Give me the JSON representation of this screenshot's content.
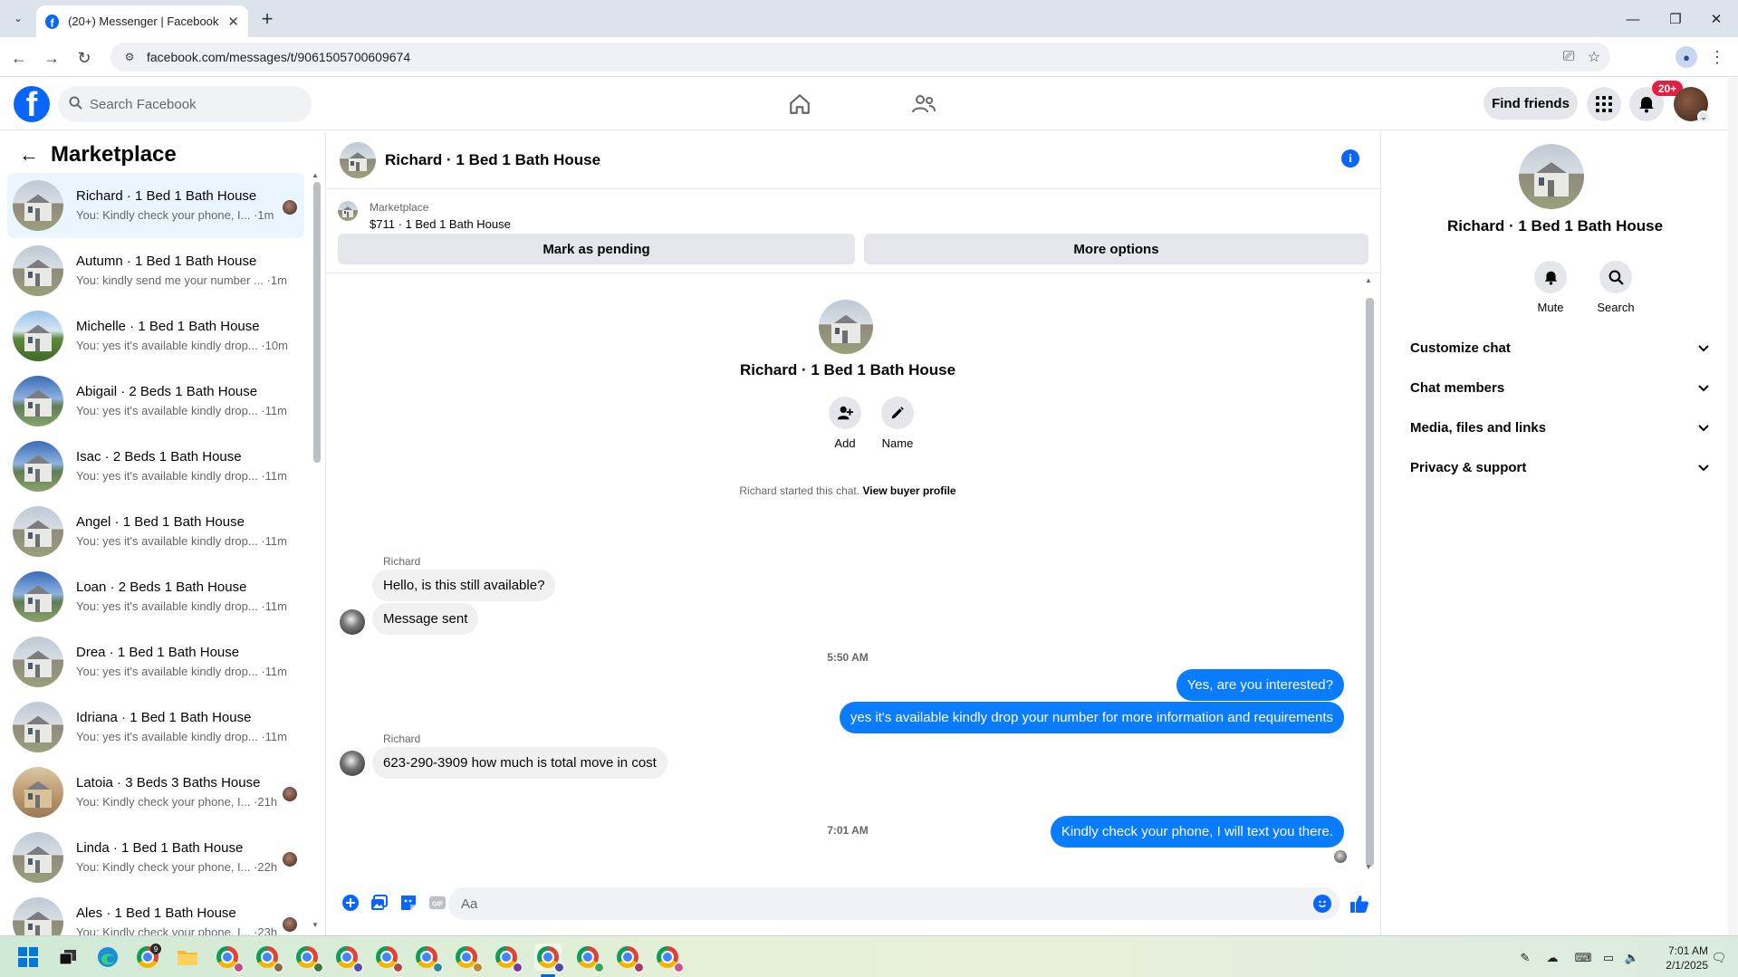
{
  "browser": {
    "tab_title": "(20+) Messenger | Facebook",
    "url": "facebook.com/messages/t/9061505700609674"
  },
  "fbnav": {
    "search_placeholder": "Search Facebook",
    "find_friends": "Find friends",
    "notification_count": "20+"
  },
  "sidebar": {
    "title": "Marketplace",
    "conversations": [
      {
        "name": "Richard · 1 Bed 1 Bath House",
        "preview": "You: Kindly check your phone, I... ·1m",
        "thumb": "gray",
        "seen": true,
        "active": true
      },
      {
        "name": "Autumn · 1 Bed 1 Bath House",
        "preview": "You: kindly send me your number ... ·1m",
        "thumb": "gray",
        "seen": false,
        "active": false
      },
      {
        "name": "Michelle · 1 Bed 1 Bath House",
        "preview": "You: yes it's available kindly drop... ·10m",
        "thumb": "green",
        "seen": false,
        "active": false
      },
      {
        "name": "Abigail · 2 Beds 1 Bath House",
        "preview": "You: yes it's available kindly drop... ·11m",
        "thumb": "blue",
        "seen": false,
        "active": false
      },
      {
        "name": "Isac · 2 Beds 1 Bath House",
        "preview": "You: yes it's available kindly drop... ·11m",
        "thumb": "blue",
        "seen": false,
        "active": false
      },
      {
        "name": "Angel · 1 Bed 1 Bath House",
        "preview": "You: yes it's available kindly drop... ·11m",
        "thumb": "gray",
        "seen": false,
        "active": false
      },
      {
        "name": "Loan · 2 Beds 1 Bath House",
        "preview": "You: yes it's available kindly drop... ·11m",
        "thumb": "blue",
        "seen": false,
        "active": false
      },
      {
        "name": "Drea · 1 Bed 1 Bath House",
        "preview": "You: yes it's available kindly drop... ·11m",
        "thumb": "gray",
        "seen": false,
        "active": false
      },
      {
        "name": "Idriana · 1 Bed 1 Bath House",
        "preview": "You: yes it's available kindly drop... ·11m",
        "thumb": "gray",
        "seen": false,
        "active": false
      },
      {
        "name": "Latoia · 3 Beds 3 Baths House",
        "preview": "You: Kindly check your phone, I... ·21h",
        "thumb": "tan",
        "seen": true,
        "active": false
      },
      {
        "name": "Linda · 1 Bed 1 Bath House",
        "preview": "You: Kindly check your phone, I... ·22h",
        "thumb": "gray",
        "seen": true,
        "active": false
      },
      {
        "name": "Ales · 1 Bed 1 Bath House",
        "preview": "You: Kindly check your phone, I... ·23h",
        "thumb": "gray",
        "seen": true,
        "active": false
      }
    ]
  },
  "chat": {
    "header_name": "Richard · 1 Bed 1 Bath House",
    "listing": {
      "source": "Marketplace",
      "price_title": "$711 · 1 Bed 1 Bath House",
      "mark_pending": "Mark as pending",
      "more_options": "More options"
    },
    "intro": {
      "name": "Richard · 1 Bed 1 Bath House",
      "add_label": "Add",
      "name_label": "Name",
      "started_text": "Richard started this chat.",
      "view_profile": "View buyer profile"
    },
    "messages": {
      "sender1": "Richard",
      "in1": "Hello, is this still available?",
      "in2": "Message sent",
      "time1": "5:50 AM",
      "out1": "Yes, are you interested?",
      "out2": "yes it's available kindly drop your number for more information and requirements",
      "sender2": "Richard",
      "in3": "623-290-3909 how much is total move in cost",
      "time2": "7:01 AM",
      "out3": "Kindly check your phone, I will text you there."
    },
    "composer_placeholder": "Aa"
  },
  "rpanel": {
    "name": "Richard · 1 Bed 1 Bath House",
    "mute": "Mute",
    "search": "Search",
    "sections": [
      "Customize chat",
      "Chat members",
      "Media, files and links",
      "Privacy & support"
    ]
  },
  "taskbar": {
    "time": "7:01 AM",
    "date": "2/1/2025",
    "badge": "9"
  },
  "colors": {
    "fb_blue": "#0866ff",
    "bubble_out": "#0a7cff",
    "bubble_in": "#f0f0f0",
    "notif_red": "#e41e3f"
  }
}
